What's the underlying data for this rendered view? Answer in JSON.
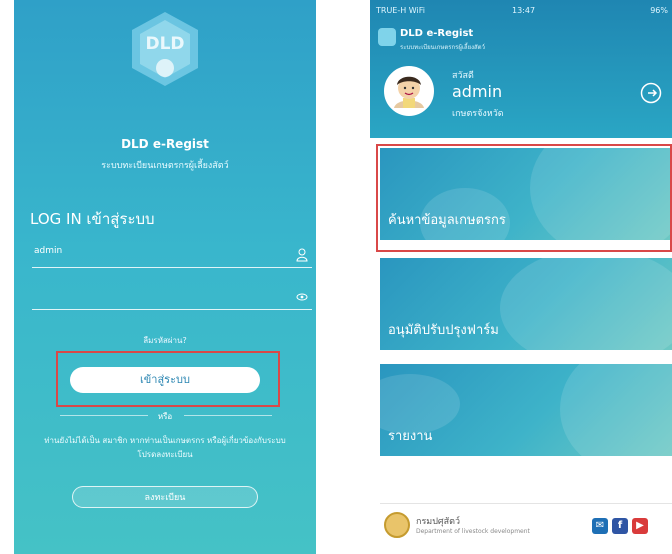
{
  "login": {
    "logo_text": "DLD",
    "app_name": "DLD e-Regist",
    "app_subtitle": "ระบบทะเบียนเกษตรกรผู้เลี้ยงสัตว์",
    "heading": "LOG IN เข้าสู่ระบบ",
    "username_value": "admin",
    "password_value": "",
    "forgot_label": "ลืมรหัสผ่าน?",
    "login_button": "เข้าสู่ระบบ",
    "or_label": "หรือ",
    "note": "ท่านยังไม่ได้เป็น สมาชิก หากท่านเป็นเกษตรกร หรือผู้เกี่ยวข้องกับระบบ โปรดลงทะเบียน",
    "register_button": "ลงทะเบียน",
    "user_icon": "user-icon",
    "eye_icon": "eye-icon"
  },
  "home": {
    "status": {
      "carrier": "TRUE-H WiFi",
      "time": "13:47",
      "battery": "96%"
    },
    "brand_name": "DLD e-Regist",
    "brand_subtitle": "ระบบทะเบียนเกษตรกรผู้เลี้ยงสัตว์",
    "greeting": "สวัสดี",
    "username": "admin",
    "role": "เกษตรจังหวัด",
    "logout_icon": "logout-icon",
    "tiles": [
      {
        "label": "ค้นหาข้อมูลเกษตรกร"
      },
      {
        "label": "อนุมัติปรับปรุงฟาร์ม"
      },
      {
        "label": "รายงาน"
      }
    ],
    "dept_name_th": "กรมปศุสัตว์",
    "dept_name_en": "Department of livestock development",
    "social": [
      "mail-icon",
      "facebook-icon",
      "youtube-icon"
    ]
  },
  "colors": {
    "primary": "#2fa0c8",
    "highlight": "#d94848"
  }
}
